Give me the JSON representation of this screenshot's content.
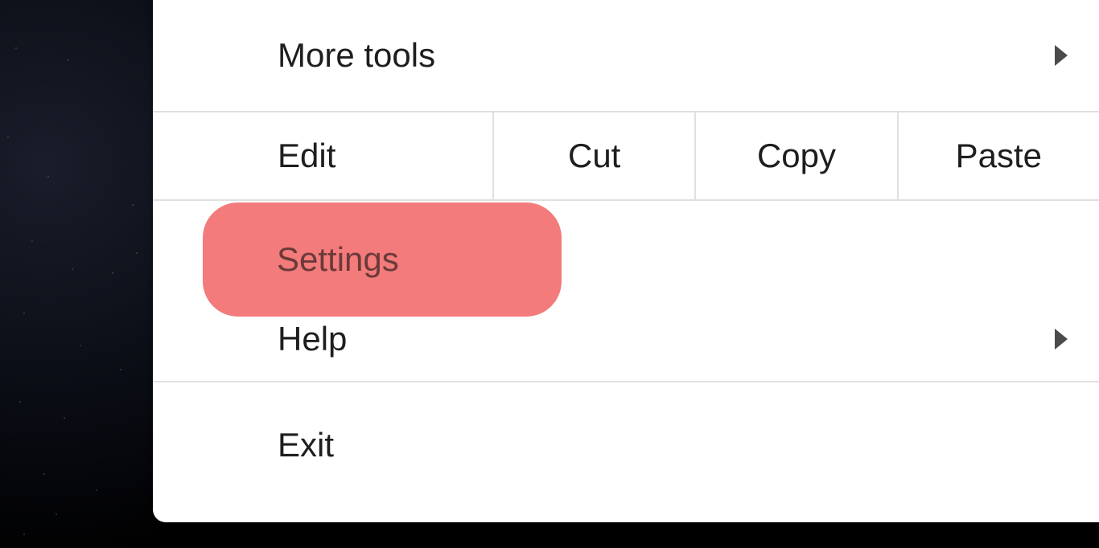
{
  "menu": {
    "more_tools": "More tools",
    "edit_label": "Edit",
    "cut": "Cut",
    "copy": "Copy",
    "paste": "Paste",
    "settings": "Settings",
    "help": "Help",
    "exit": "Exit"
  }
}
